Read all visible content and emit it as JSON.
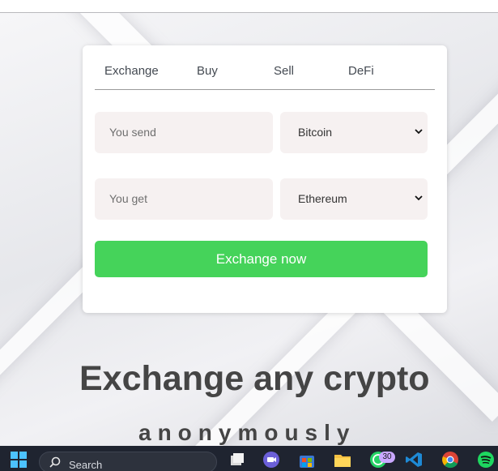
{
  "tabs": [
    "Exchange",
    "Buy",
    "Sell",
    "DeFi"
  ],
  "form": {
    "send_placeholder": "You send",
    "get_placeholder": "You get",
    "send_currency": "Bitcoin",
    "get_currency": "Ethereum",
    "submit_label": "Exchange now"
  },
  "hero": {
    "title": "Exchange any crypto",
    "subtitle": "anonymously"
  },
  "taskbar": {
    "search_label": "Search",
    "whatsapp_badge": "30",
    "icons": [
      "windows-start-icon",
      "search-icon",
      "task-view-icon",
      "teams-icon",
      "store-icon",
      "file-explorer-icon",
      "whatsapp-icon",
      "vscode-icon",
      "chrome-icon",
      "spotify-icon"
    ]
  },
  "colors": {
    "accent_green": "#45d35a",
    "field_bg": "#f6f1f1",
    "text_dark": "#454545"
  }
}
